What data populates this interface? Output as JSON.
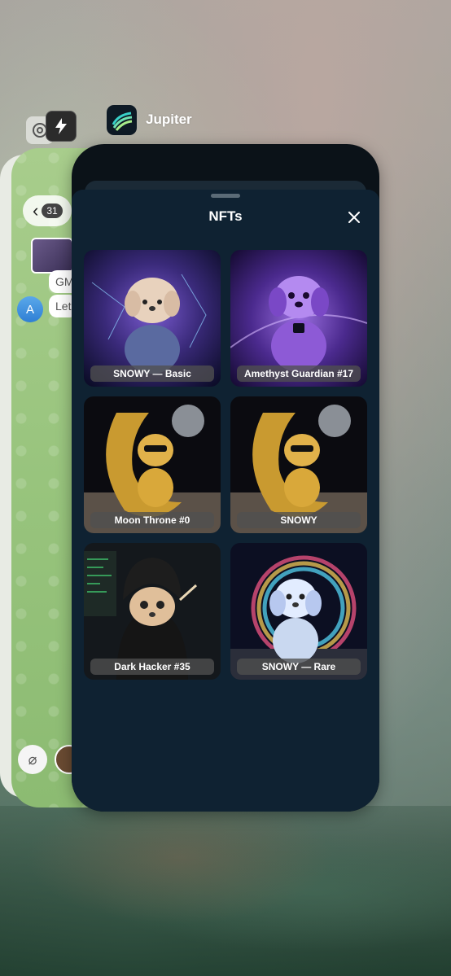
{
  "switcher": {
    "apps": [
      {
        "name": "chatgpt-icon"
      },
      {
        "name": "bolt-icon"
      },
      {
        "name": "jupiter-icon",
        "label": "Jupiter"
      }
    ]
  },
  "telegram_preview": {
    "back_count": "31",
    "messages": [
      "GM",
      "Let"
    ],
    "avatar_letter": "A"
  },
  "sheet": {
    "title": "NFTs",
    "close_icon": "close-icon"
  },
  "nfts": [
    {
      "label": "SNOWY — Basic",
      "theme": "cosmic"
    },
    {
      "label": "Amethyst Guardian #17",
      "theme": "amethyst"
    },
    {
      "label": "Moon Throne #0",
      "theme": "gold-moon"
    },
    {
      "label": "SNOWY",
      "theme": "gold-moon"
    },
    {
      "label": "Dark Hacker #35",
      "theme": "hacker"
    },
    {
      "label": "SNOWY — Rare",
      "theme": "rainbow"
    }
  ],
  "colors": {
    "sheet_bg": "#0f2232",
    "label_bg": "#505050",
    "text": "#ffffff"
  }
}
